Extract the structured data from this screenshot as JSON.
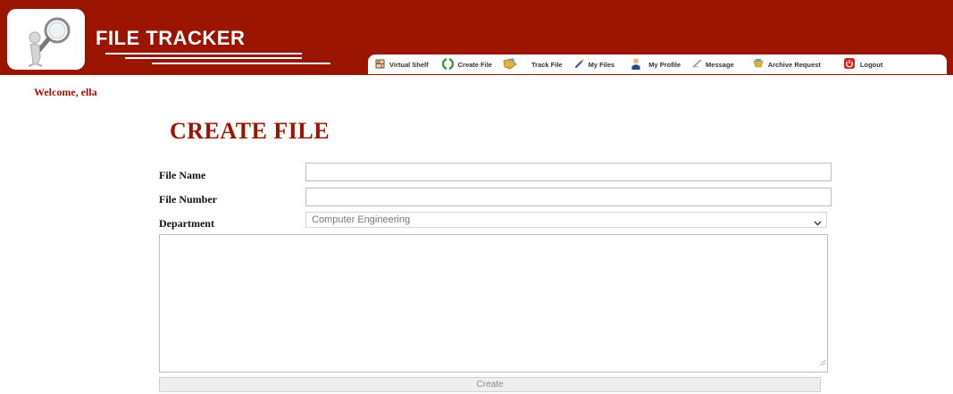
{
  "app": {
    "title": "FILE TRACKER"
  },
  "nav": {
    "items": [
      {
        "label": "Virtual Shelf",
        "icon": "bookshelf-icon"
      },
      {
        "label": "Create File",
        "icon": "refresh-arrows-icon"
      },
      {
        "label": "Track File",
        "icon": "tag-icon"
      },
      {
        "label": "My Files",
        "icon": "pencil-icon"
      },
      {
        "label": "My Profile",
        "icon": "user-icon"
      },
      {
        "label": "Message",
        "icon": "pen-icon"
      },
      {
        "label": "Archive Request",
        "icon": "archive-icon"
      },
      {
        "label": "Logout",
        "icon": "power-icon"
      }
    ]
  },
  "welcome": "Welcome, ella",
  "form": {
    "title": "CREATE FILE",
    "file_name_label": "File Name",
    "file_name_value": "",
    "file_number_label": "File Number",
    "file_number_value": "",
    "department_label": "Department",
    "department_value": "Computer Engineering",
    "description_value": "",
    "submit_label": "Create"
  },
  "colors": {
    "brand": "#9b1400",
    "button_bg": "#efefef"
  }
}
